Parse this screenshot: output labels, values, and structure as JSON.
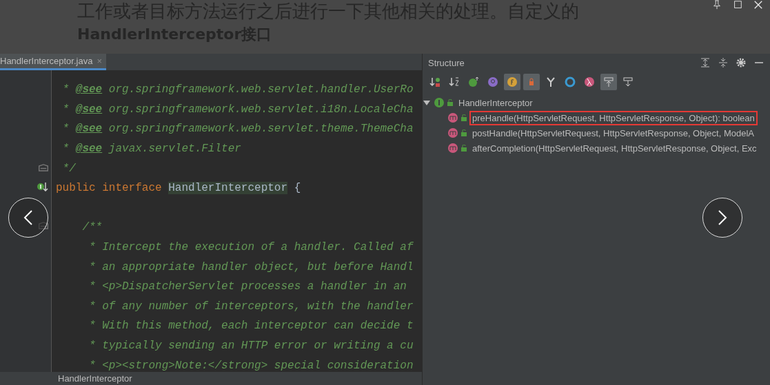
{
  "article": {
    "line": "工作或者目标方法运行之后进行一下其他相关的处理。自定义的",
    "heading": "HandlerInterceptor接口"
  },
  "viewer_controls": [
    {
      "kind": "pin"
    },
    {
      "kind": "maximize"
    },
    {
      "kind": "close"
    }
  ],
  "editor": {
    "tab": {
      "label": "HandlerInterceptor.java",
      "close": "×",
      "selected": true
    },
    "lines": [
      {
        "parts": [
          {
            "kind": "comment",
            "text": " * "
          },
          {
            "kind": "tag",
            "text": "@see"
          },
          {
            "kind": "comment",
            "text": " org.springframework.web.servlet.handler.UserRo"
          }
        ]
      },
      {
        "parts": [
          {
            "kind": "comment",
            "text": " * "
          },
          {
            "kind": "tag",
            "text": "@see"
          },
          {
            "kind": "comment",
            "text": " org.springframework.web.servlet.i18n.LocaleCha"
          }
        ]
      },
      {
        "parts": [
          {
            "kind": "comment",
            "text": " * "
          },
          {
            "kind": "tag",
            "text": "@see"
          },
          {
            "kind": "comment",
            "text": " org.springframework.web.servlet.theme.ThemeCha"
          }
        ]
      },
      {
        "parts": [
          {
            "kind": "comment",
            "text": " * "
          },
          {
            "kind": "tag",
            "text": "@see"
          },
          {
            "kind": "comment",
            "text": " javax.servlet.Filter"
          }
        ]
      },
      {
        "kind": "fold",
        "parts": [
          {
            "kind": "comment",
            "text": " */"
          }
        ]
      },
      {
        "kind": "implemented",
        "parts": [
          {
            "kind": "keyword",
            "text": "public interface "
          },
          {
            "kind": "ident",
            "text": "HandlerInterceptor"
          },
          {
            "kind": "plain",
            "text": " {"
          }
        ]
      },
      {
        "kind": "blank"
      },
      {
        "kind": "fold",
        "parts": [
          {
            "kind": "comment",
            "text": "    /**"
          }
        ]
      },
      {
        "parts": [
          {
            "kind": "comment",
            "text": "     * Intercept the execution of a handler. Called af"
          }
        ]
      },
      {
        "parts": [
          {
            "kind": "comment",
            "text": "     * an appropriate handler object, but before Handl"
          }
        ]
      },
      {
        "parts": [
          {
            "kind": "comment",
            "text": "     * <p>DispatcherServlet processes a handler in an"
          }
        ]
      },
      {
        "parts": [
          {
            "kind": "comment",
            "text": "     * of any number of interceptors, with the handler"
          }
        ]
      },
      {
        "parts": [
          {
            "kind": "comment",
            "text": "     * With this method, each interceptor can decide t"
          }
        ]
      },
      {
        "parts": [
          {
            "kind": "comment",
            "text": "     * typically sending an HTTP error or writing a cu"
          }
        ]
      },
      {
        "parts": [
          {
            "kind": "comment",
            "text": "     * <p><strong>Note:</strong> special consideration"
          }
        ]
      }
    ],
    "breadcrumb": "HandlerInterceptor"
  },
  "structure": {
    "title": "Structure",
    "header_actions": [
      {
        "kind": "expand-all"
      },
      {
        "kind": "collapse-all"
      },
      {
        "kind": "settings"
      },
      {
        "kind": "minimize"
      }
    ],
    "toolbar": [
      {
        "kind": "sort-visibility",
        "on": false
      },
      {
        "kind": "sort-alpha",
        "on": false
      },
      {
        "kind": "inherited",
        "on": false
      },
      {
        "kind": "properties",
        "on": false
      },
      {
        "kind": "fields",
        "on": true
      },
      {
        "kind": "non-public",
        "on": true
      },
      {
        "kind": "lambdas-branch",
        "on": false
      },
      {
        "kind": "anonymous",
        "on": false
      },
      {
        "kind": "lambda",
        "on": false
      },
      {
        "kind": "autoscroll-to-source",
        "on": true
      },
      {
        "kind": "autoscroll-from-source",
        "on": false
      }
    ],
    "tree": [
      {
        "label": "HandlerInterceptor",
        "kind": "interface",
        "expanded": true,
        "selected": false,
        "children": [
          {
            "label": "preHandle(HttpServletRequest, HttpServletResponse, Object): boolean",
            "kind": "method",
            "selected": true
          },
          {
            "label": "postHandle(HttpServletRequest, HttpServletResponse, Object, ModelA",
            "kind": "method",
            "selected": false
          },
          {
            "label": "afterCompletion(HttpServletRequest, HttpServletResponse, Object, Exc",
            "kind": "method",
            "selected": false
          }
        ]
      }
    ]
  },
  "nav": [
    {
      "kind": "previous"
    },
    {
      "kind": "next"
    }
  ]
}
